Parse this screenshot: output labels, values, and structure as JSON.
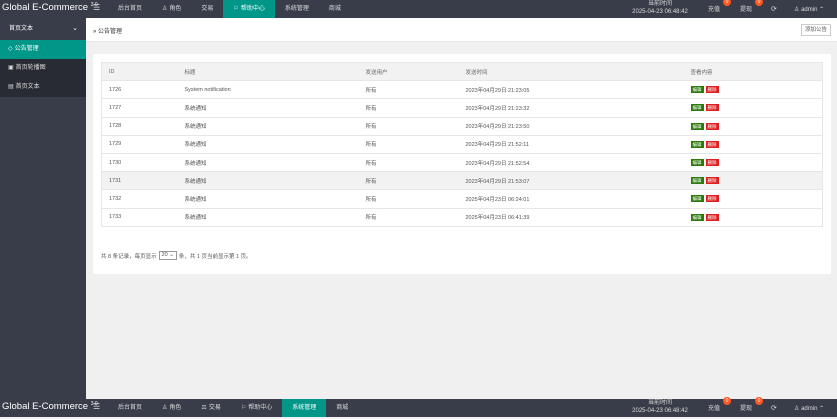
{
  "app": {
    "brand": "Global E-Commerce",
    "version": "3.0"
  },
  "header": {
    "toggle_icon": "menu-icon",
    "nav_top": [
      {
        "label": "后台首页",
        "icon": "",
        "active": false
      },
      {
        "label": "角色",
        "icon": "user-icon",
        "active": false
      },
      {
        "label": "交易",
        "icon": "",
        "active": false
      },
      {
        "label": "帮助中心",
        "icon": "flag-icon",
        "active": true
      },
      {
        "label": "系统管理",
        "icon": "",
        "active": false
      },
      {
        "label": "商城",
        "icon": "",
        "active": false
      }
    ],
    "nav_bottom": [
      {
        "label": "后台首页",
        "icon": "",
        "active": false
      },
      {
        "label": "角色",
        "icon": "user-icon",
        "active": false
      },
      {
        "label": "交易",
        "icon": "trade-icon",
        "active": false
      },
      {
        "label": "帮助中心",
        "icon": "flag-icon",
        "active": false
      },
      {
        "label": "系统管理",
        "icon": "",
        "active": true
      },
      {
        "label": "商城",
        "icon": "",
        "active": false
      }
    ],
    "clock_label": "当前时间",
    "clock_value": "2025-04-23 06:48:42",
    "recharge": {
      "label": "充值",
      "badge": "0"
    },
    "withdraw": {
      "label": "提现",
      "badge": "0"
    },
    "user": "admin"
  },
  "sidebar": {
    "section": "首页文本",
    "items": [
      {
        "label": "公告管理",
        "active": true
      },
      {
        "label": "首页轮播图",
        "active": false
      },
      {
        "label": "首页文本",
        "active": false
      }
    ]
  },
  "page": {
    "breadcrumb": "公告管理",
    "add_button": "添加公告"
  },
  "table": {
    "columns": [
      "ID",
      "标题",
      "发送用户",
      "发送时间",
      "查看内容"
    ],
    "rows": [
      {
        "id": "1726",
        "title": "System notification",
        "user": "所有",
        "time": "2023年04月29日 21:23:05"
      },
      {
        "id": "1727",
        "title": "系统通知",
        "user": "所有",
        "time": "2023年04月29日 21:23:32"
      },
      {
        "id": "1728",
        "title": "系统通知",
        "user": "所有",
        "time": "2023年04月29日 21:23:50"
      },
      {
        "id": "1729",
        "title": "系统通知",
        "user": "所有",
        "time": "2023年04月29日 21:52:11"
      },
      {
        "id": "1730",
        "title": "系统通知",
        "user": "所有",
        "time": "2023年04月29日 21:52:54"
      },
      {
        "id": "1731",
        "title": "系统通知",
        "user": "所有",
        "time": "2023年04月29日 21:53:07"
      },
      {
        "id": "1732",
        "title": "系统通知",
        "user": "所有",
        "time": "2025年04月23日 06:24:01"
      },
      {
        "id": "1733",
        "title": "系统通知",
        "user": "所有",
        "time": "2025年04月23日 06:41:39"
      }
    ],
    "edit_label": "编辑",
    "delete_label": "删除"
  },
  "pager": {
    "prefix": "共 8 条记录，每页显示",
    "page_size": "20",
    "suffix": "条，共 1 页当前显示第 1 页。"
  }
}
